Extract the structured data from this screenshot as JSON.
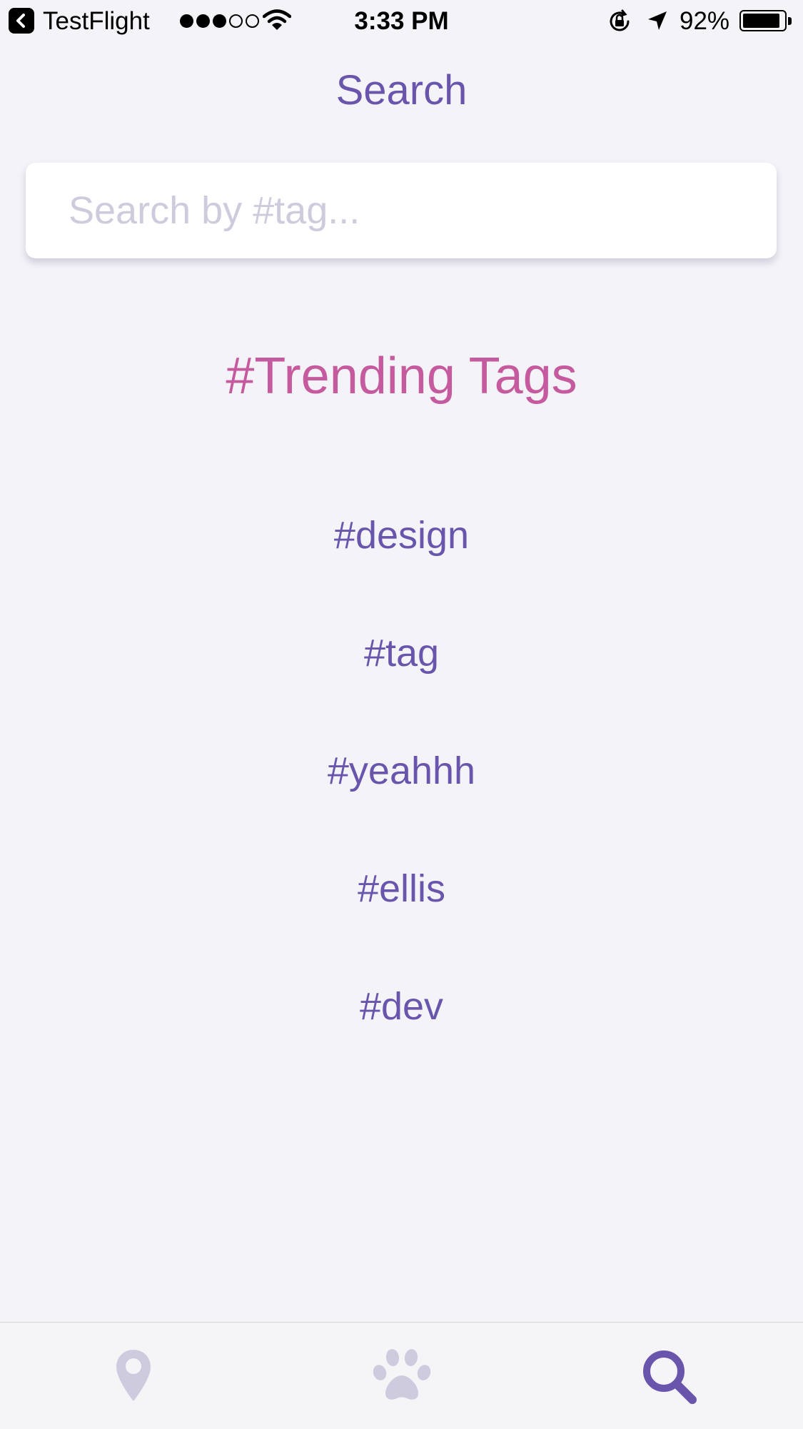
{
  "status_bar": {
    "back_app": "TestFlight",
    "time": "3:33 PM",
    "battery_percent": "92%",
    "battery_level": 0.92,
    "signal_bars": 3,
    "signal_total": 5
  },
  "header": {
    "title": "Search"
  },
  "search": {
    "placeholder": "Search by #tag...",
    "value": ""
  },
  "trending": {
    "title": "#Trending Tags",
    "tags": [
      "#design",
      "#tag",
      "#yeahhh",
      "#ellis",
      "#dev"
    ]
  },
  "tab_bar": {
    "tabs": [
      {
        "icon": "map-pin-icon",
        "active": false
      },
      {
        "icon": "paw-icon",
        "active": false
      },
      {
        "icon": "search-icon",
        "active": true
      }
    ]
  },
  "colors": {
    "primary": "#6a55ad",
    "accent": "#c55b9e",
    "inactive_icon": "#cecbdf",
    "background": "#f3f3f8"
  }
}
